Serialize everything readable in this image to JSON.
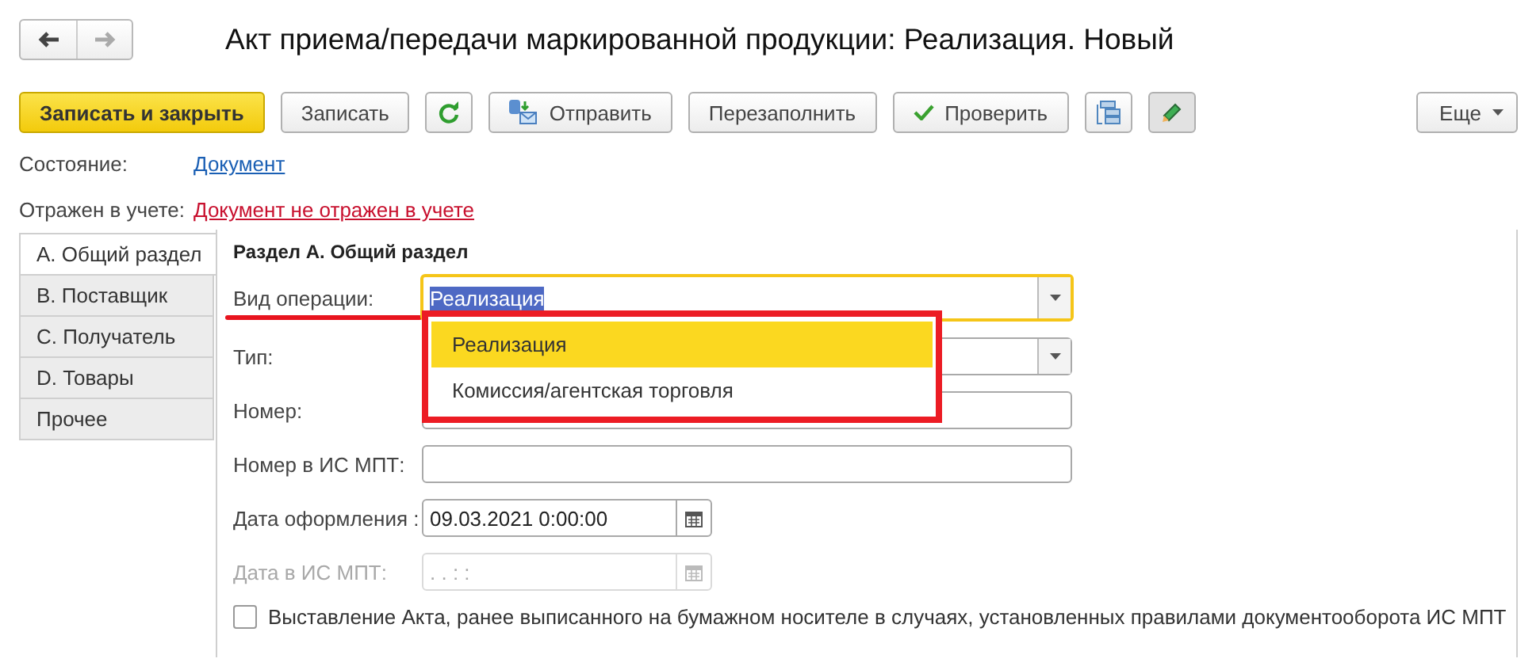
{
  "title": "Акт приема/передачи маркированной продукции: Реализация. Новый",
  "toolbar": [
    {
      "kind": "primary",
      "label": "Записать и закрыть",
      "pressed": false
    },
    {
      "kind": "plain",
      "label": "Записать",
      "pressed": false
    },
    {
      "kind": "refresh",
      "pressed": false
    },
    {
      "kind": "send",
      "label": "Отправить",
      "pressed": false
    },
    {
      "kind": "plain",
      "label": "Перезаполнить",
      "pressed": false
    },
    {
      "kind": "check",
      "label": "Проверить",
      "pressed": false
    },
    {
      "kind": "structure",
      "pressed": false
    },
    {
      "kind": "edit",
      "pressed": true
    },
    {
      "kind": "more",
      "label": "Еще",
      "pressed": false
    }
  ],
  "status": [
    {
      "label": "Состояние:",
      "link": "Документ",
      "color": "#1a5fb4"
    },
    {
      "label": "Отражен в учете:",
      "link": "Документ не отражен в учете",
      "color": "#c8102e"
    }
  ],
  "tabs": [
    {
      "label": "A. Общий раздел",
      "selected": true
    },
    {
      "label": "B. Поставщик",
      "selected": false
    },
    {
      "label": "C. Получатель",
      "selected": false
    },
    {
      "label": "D. Товары",
      "selected": false
    },
    {
      "label": "Прочее",
      "selected": false
    }
  ],
  "section_title": "Раздел А. Общий раздел",
  "fields": [
    {
      "kind": "select",
      "label": "Вид операции:",
      "value": "Реализация",
      "focused": true,
      "disabled": false
    },
    {
      "kind": "select",
      "label": "Тип:",
      "focused": false,
      "disabled": false
    },
    {
      "kind": "text",
      "label": "Номер:",
      "focused": false,
      "disabled": false
    },
    {
      "kind": "text",
      "label": "Номер в ИС МПТ:",
      "focused": false,
      "disabled": false
    },
    {
      "kind": "date",
      "label": "Дата оформления :",
      "value": "09.03.2021  0:00:00",
      "focused": false,
      "disabled": false
    },
    {
      "kind": "date",
      "label": "Дата в ИС МПТ:",
      "value": ".  .       :  :",
      "focused": false,
      "disabled": true
    }
  ],
  "checkbox": {
    "label": "Выставление Акта, ранее выписанного на бумажном носителе в случаях, установленных правилами документооборота ИС МПТ",
    "checked": false
  },
  "dropdown": {
    "items": [
      {
        "label": "Реализация",
        "selected": true
      },
      {
        "label": "Комиссия/агентская торговля",
        "selected": false
      }
    ]
  }
}
